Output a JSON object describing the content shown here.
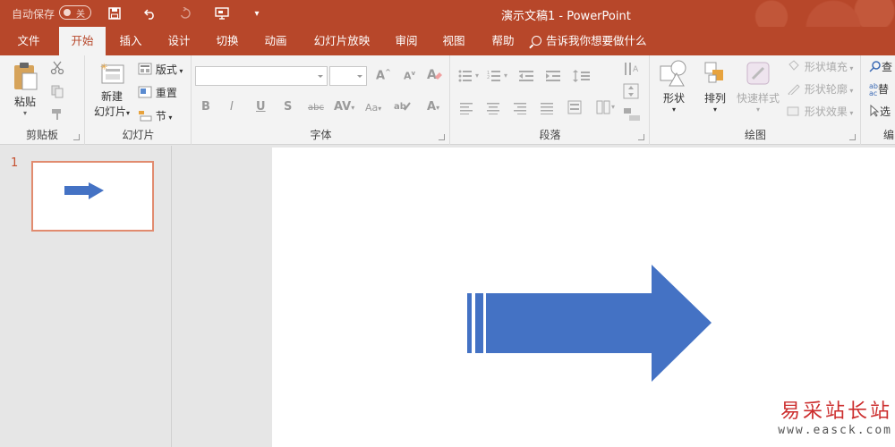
{
  "titlebar": {
    "autosave_label": "自动保存",
    "autosave_state": "关",
    "document_title": "演示文稿1  -  PowerPoint",
    "accent_color": "#b7472a",
    "qat_icons": [
      "save-icon",
      "undo-icon",
      "redo-icon",
      "presentation-icon",
      "customize-qat-icon"
    ]
  },
  "tabs": [
    {
      "label": "文件",
      "active": false
    },
    {
      "label": "开始",
      "active": true
    },
    {
      "label": "插入",
      "active": false
    },
    {
      "label": "设计",
      "active": false
    },
    {
      "label": "切换",
      "active": false
    },
    {
      "label": "动画",
      "active": false
    },
    {
      "label": "幻灯片放映",
      "active": false
    },
    {
      "label": "审阅",
      "active": false
    },
    {
      "label": "视图",
      "active": false
    },
    {
      "label": "帮助",
      "active": false
    }
  ],
  "tell_me": "告诉我你想要做什么",
  "ribbon": {
    "clipboard": {
      "label": "剪贴板",
      "paste": "粘贴"
    },
    "slides": {
      "label": "幻灯片",
      "new_slide_line1": "新建",
      "new_slide_line2": "幻灯片",
      "layout": "版式",
      "reset": "重置",
      "section": "节"
    },
    "font": {
      "label": "字体",
      "font_name": "",
      "font_size": "",
      "bold": "B",
      "italic": "I",
      "underline": "U",
      "shadow": "S",
      "strike": "abc",
      "spacing": "AV",
      "case": "Aa",
      "grow": "A",
      "shrink": "A",
      "color": "A"
    },
    "paragraph": {
      "label": "段落"
    },
    "drawing": {
      "label": "绘图",
      "shapes": "形状",
      "arrange": "排列",
      "quick_styles": "快速样式",
      "shape_fill": "形状填充",
      "shape_outline": "形状轮廓",
      "shape_effects": "形状效果"
    },
    "editing": {
      "label": "编",
      "find": "查",
      "replace": "替",
      "select": "选"
    }
  },
  "thumbnails": [
    {
      "number": "1",
      "selected": true
    }
  ],
  "slide": {
    "shape": "striped-right-arrow",
    "shape_color": "#4472c4"
  },
  "watermark": {
    "title": "易采站长站",
    "url": "www.easck.com"
  }
}
